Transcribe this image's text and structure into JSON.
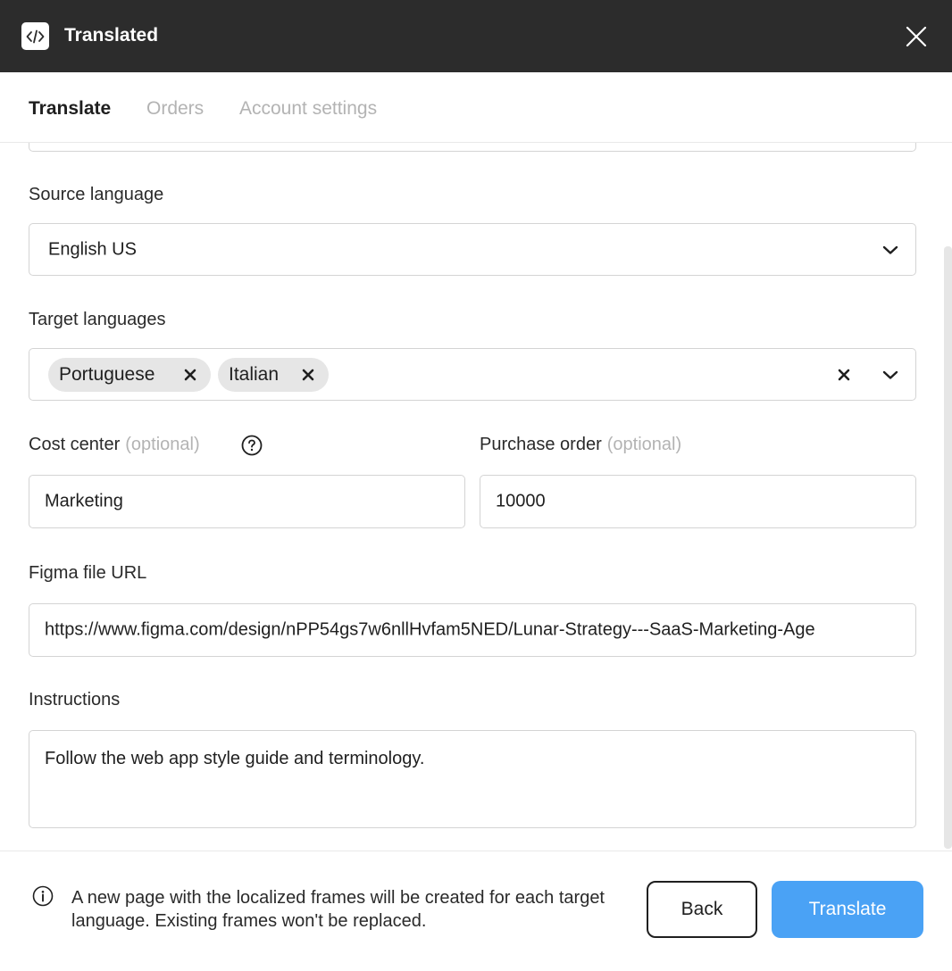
{
  "window": {
    "title": "Translated",
    "logo_icon": "code-brackets-icon",
    "close_icon": "close-icon"
  },
  "tabs": [
    {
      "label": "Translate",
      "active": true
    },
    {
      "label": "Orders",
      "active": false
    },
    {
      "label": "Account settings",
      "active": false
    }
  ],
  "form": {
    "source_language": {
      "label": "Source language",
      "value": "English US"
    },
    "target_languages": {
      "label": "Target languages",
      "selected": [
        "Portuguese",
        "Italian"
      ]
    },
    "cost_center": {
      "label": "Cost center",
      "optional": "(optional)",
      "value": "Marketing"
    },
    "purchase_order": {
      "label": "Purchase order",
      "optional": "(optional)",
      "value": "10000"
    },
    "figma_url": {
      "label": "Figma file URL",
      "value": "https://www.figma.com/design/nPP54gs7w6nllHvfam5NED/Lunar-Strategy---SaaS-Marketing-Age"
    },
    "instructions": {
      "label": "Instructions",
      "value": "Follow the web app style guide and terminology."
    }
  },
  "footer": {
    "note": "A new page with the localized frames will be created for each target language. Existing frames won't be replaced.",
    "back_label": "Back",
    "translate_label": "Translate"
  },
  "colors": {
    "titlebar": "#2c2c2c",
    "primary_button": "#4aa2f5",
    "muted_text": "#b3b3b3",
    "chip_bg": "#e6e6e6"
  }
}
